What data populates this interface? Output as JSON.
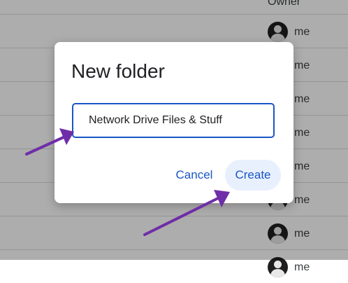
{
  "file_list": {
    "owner_header": "Owner",
    "owners": [
      "me",
      "me",
      "me",
      "me",
      "me",
      "me",
      "me",
      "me"
    ]
  },
  "dialog": {
    "title": "New folder",
    "input_value": "Network Drive Files & Stuff",
    "cancel_label": "Cancel",
    "create_label": "Create"
  },
  "colors": {
    "accent": "#1a56c4",
    "create_button_bg": "#e8f0fe",
    "annotation_arrow": "#6f2da8"
  },
  "icons": {
    "owner_avatar": "avatar-icon",
    "annotation": "arrow-icon"
  }
}
